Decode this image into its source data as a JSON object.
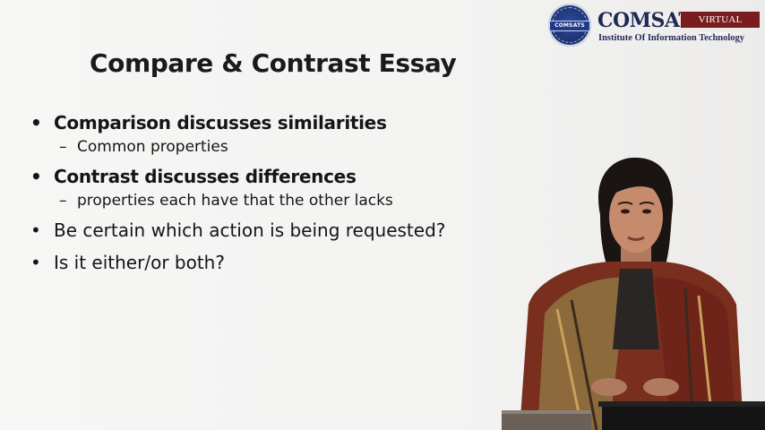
{
  "logo": {
    "seal_text": "COMSATS",
    "name": "COMSATS",
    "badge": "VIRTUAL CAMPUS",
    "subtitle": "Institute Of Information Technology",
    "colors": {
      "navy": "#1f2a55",
      "badge": "#7a1d1f"
    }
  },
  "slide": {
    "title": "Compare & Contrast Essay",
    "bullets": [
      {
        "text": "Comparison discusses similarities",
        "sub": "Common properties"
      },
      {
        "text": "Contrast discusses differences",
        "sub": "properties each have that the other lacks"
      },
      {
        "text": "Be certain which action is being requested?"
      },
      {
        "text": "Is it either/or both?"
      }
    ],
    "bullet_glyph": "•",
    "dash_glyph": "–"
  },
  "presenter": {
    "icon": "presenter-figure"
  }
}
